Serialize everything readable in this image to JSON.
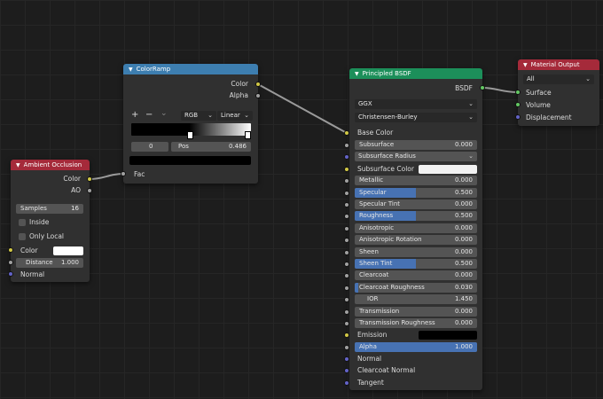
{
  "ambient_occlusion": {
    "title": "Ambient Occlusion",
    "out_color": "Color",
    "out_ao": "AO",
    "samples_label": "Samples",
    "samples_value": "16",
    "inside_label": "Inside",
    "only_local_label": "Only Local",
    "in_color": "Color",
    "distance_label": "Distance",
    "distance_value": "1.000",
    "normal_label": "Normal",
    "color_swatch": "#ffffff"
  },
  "color_ramp": {
    "title": "ColorRamp",
    "out_color": "Color",
    "out_alpha": "Alpha",
    "add_label": "+",
    "remove_label": "−",
    "menu_label": "⌄",
    "color_mode": "RGB",
    "interpolation": "Linear",
    "stop_index": "0",
    "pos_label": "Pos",
    "pos_value": "0.486",
    "in_fac": "Fac",
    "selected_stop_color": "#000000"
  },
  "principled_bsdf": {
    "title": "Principled BSDF",
    "out_bsdf": "BSDF",
    "distribution": "GGX",
    "subsurface_method": "Christensen-Burley",
    "base_color_label": "Base Color",
    "rows": [
      {
        "label": "Subsurface",
        "value": "0.000",
        "fill": 0.0
      },
      {
        "label": "Subsurface Radius",
        "value": "",
        "fill": 0.0
      },
      {
        "label": "Subsurface Color",
        "value": "",
        "fill": 0.0
      },
      {
        "label": "Metallic",
        "value": "0.000",
        "fill": 0.0
      },
      {
        "label": "Specular",
        "value": "0.500",
        "fill": 0.5
      },
      {
        "label": "Specular Tint",
        "value": "0.000",
        "fill": 0.0
      },
      {
        "label": "Roughness",
        "value": "0.500",
        "fill": 0.5
      },
      {
        "label": "Anisotropic",
        "value": "0.000",
        "fill": 0.0
      },
      {
        "label": "Anisotropic Rotation",
        "value": "0.000",
        "fill": 0.0
      },
      {
        "label": "Sheen",
        "value": "0.000",
        "fill": 0.0
      },
      {
        "label": "Sheen Tint",
        "value": "0.500",
        "fill": 0.5
      },
      {
        "label": "Clearcoat",
        "value": "0.000",
        "fill": 0.0
      },
      {
        "label": "Clearcoat Roughness",
        "value": "0.030",
        "fill": 0.03
      },
      {
        "label": "IOR",
        "value": "1.450",
        "fill": 0.0
      },
      {
        "label": "Transmission",
        "value": "0.000",
        "fill": 0.0
      },
      {
        "label": "Transmission Roughness",
        "value": "0.000",
        "fill": 0.0
      },
      {
        "label": "Emission",
        "value": "",
        "fill": 0.0
      },
      {
        "label": "Alpha",
        "value": "1.000",
        "fill": 1.0
      }
    ],
    "normal_label": "Normal",
    "clearcoat_normal_label": "Clearcoat Normal",
    "tangent_label": "Tangent",
    "subsurface_color_swatch": "#f2f2f2",
    "emission_swatch": "#000000"
  },
  "material_output": {
    "title": "Material Output",
    "target": "All",
    "surface_label": "Surface",
    "volume_label": "Volume",
    "displacement_label": "Displacement"
  }
}
